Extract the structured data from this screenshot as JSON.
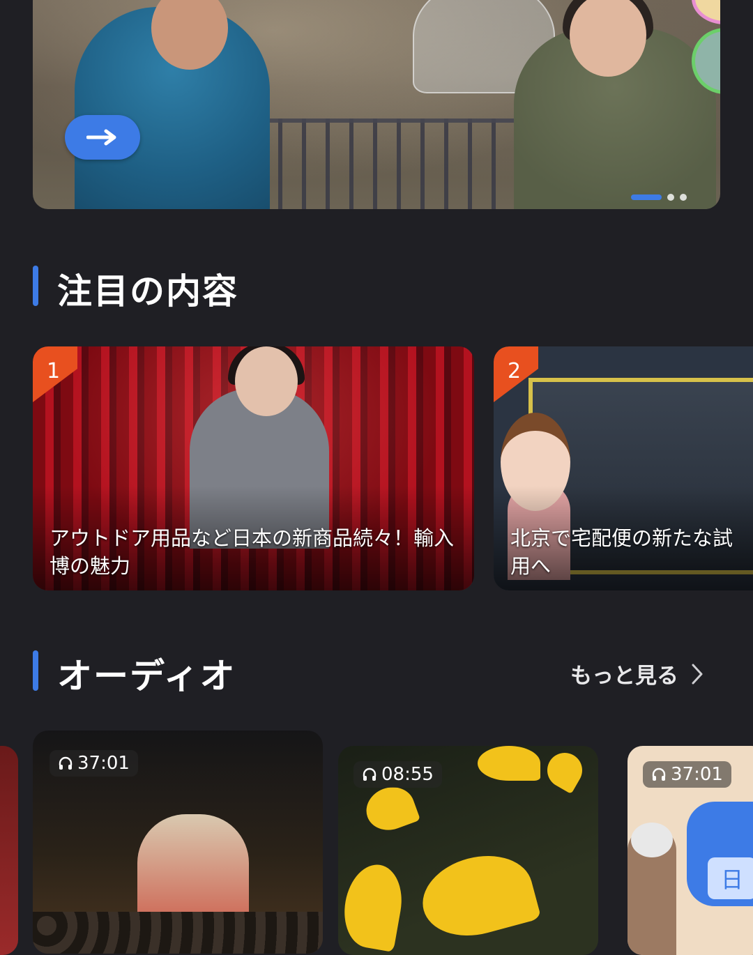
{
  "banner": {
    "arrow_label": "→"
  },
  "featured": {
    "title": "注目の内容",
    "cards": [
      {
        "rank": "1",
        "title": "アウトドア用品など日本の新商品続々！輸入博の魅力"
      },
      {
        "rank": "2",
        "title": "北京で宅配便の新たな試用へ"
      }
    ]
  },
  "audio": {
    "title": "オーディオ",
    "more_label": "もっと見る",
    "items": [
      {
        "duration": "37:01"
      },
      {
        "duration": "08:55"
      },
      {
        "duration": "37:01"
      }
    ]
  },
  "colors": {
    "accent": "#3d7be6",
    "rank_badge": "#e8501f",
    "background": "#1f1f24"
  }
}
